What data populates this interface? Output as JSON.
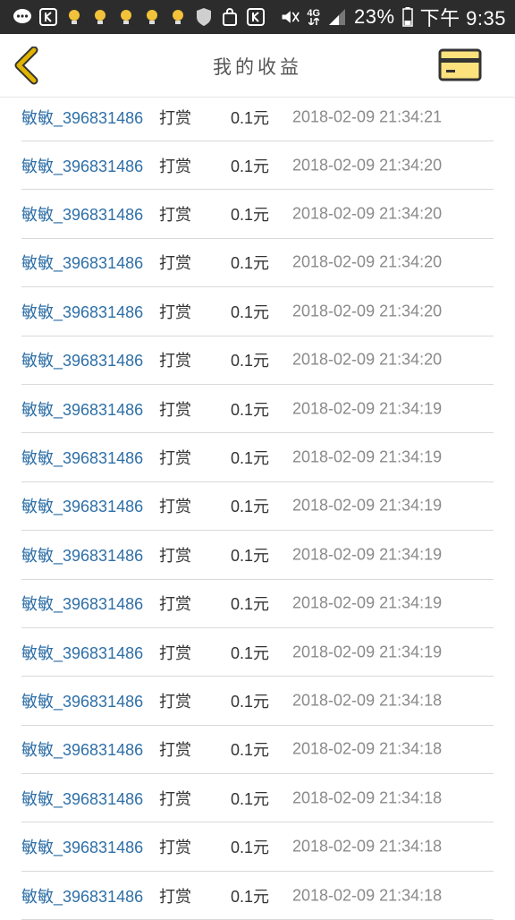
{
  "status_bar": {
    "network": "4G",
    "battery": "23%",
    "time": "下午 9:35"
  },
  "header": {
    "title": "我的收益",
    "colors": {
      "back_icon": "#e0b400",
      "card_icon_fill": "#fbe27d",
      "card_icon_border": "#333333"
    }
  },
  "records": [
    {
      "user": "敏敏_396831486",
      "action": "打赏",
      "amount": "0.1元",
      "time": "2018-02-09 21:34:21"
    },
    {
      "user": "敏敏_396831486",
      "action": "打赏",
      "amount": "0.1元",
      "time": "2018-02-09 21:34:20"
    },
    {
      "user": "敏敏_396831486",
      "action": "打赏",
      "amount": "0.1元",
      "time": "2018-02-09 21:34:20"
    },
    {
      "user": "敏敏_396831486",
      "action": "打赏",
      "amount": "0.1元",
      "time": "2018-02-09 21:34:20"
    },
    {
      "user": "敏敏_396831486",
      "action": "打赏",
      "amount": "0.1元",
      "time": "2018-02-09 21:34:20"
    },
    {
      "user": "敏敏_396831486",
      "action": "打赏",
      "amount": "0.1元",
      "time": "2018-02-09 21:34:20"
    },
    {
      "user": "敏敏_396831486",
      "action": "打赏",
      "amount": "0.1元",
      "time": "2018-02-09 21:34:19"
    },
    {
      "user": "敏敏_396831486",
      "action": "打赏",
      "amount": "0.1元",
      "time": "2018-02-09 21:34:19"
    },
    {
      "user": "敏敏_396831486",
      "action": "打赏",
      "amount": "0.1元",
      "time": "2018-02-09 21:34:19"
    },
    {
      "user": "敏敏_396831486",
      "action": "打赏",
      "amount": "0.1元",
      "time": "2018-02-09 21:34:19"
    },
    {
      "user": "敏敏_396831486",
      "action": "打赏",
      "amount": "0.1元",
      "time": "2018-02-09 21:34:19"
    },
    {
      "user": "敏敏_396831486",
      "action": "打赏",
      "amount": "0.1元",
      "time": "2018-02-09 21:34:19"
    },
    {
      "user": "敏敏_396831486",
      "action": "打赏",
      "amount": "0.1元",
      "time": "2018-02-09 21:34:18"
    },
    {
      "user": "敏敏_396831486",
      "action": "打赏",
      "amount": "0.1元",
      "time": "2018-02-09 21:34:18"
    },
    {
      "user": "敏敏_396831486",
      "action": "打赏",
      "amount": "0.1元",
      "time": "2018-02-09 21:34:18"
    },
    {
      "user": "敏敏_396831486",
      "action": "打赏",
      "amount": "0.1元",
      "time": "2018-02-09 21:34:18"
    },
    {
      "user": "敏敏_396831486",
      "action": "打赏",
      "amount": "0.1元",
      "time": "2018-02-09 21:34:18"
    }
  ]
}
